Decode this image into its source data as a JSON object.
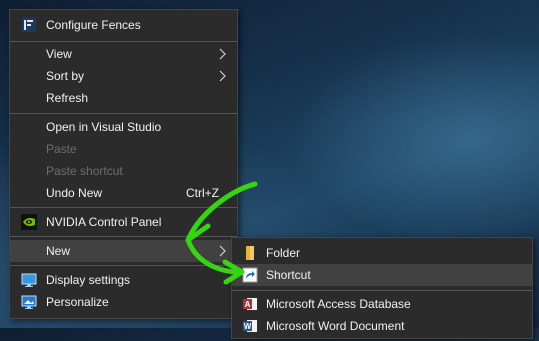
{
  "context_menu": {
    "configure_fences": "Configure Fences",
    "view": "View",
    "sort_by": "Sort by",
    "refresh": "Refresh",
    "open_in_visual_studio": "Open in Visual Studio",
    "paste": "Paste",
    "paste_shortcut": "Paste shortcut",
    "undo_new": "Undo New",
    "undo_new_shortcut": "Ctrl+Z",
    "nvidia_control_panel": "NVIDIA Control Panel",
    "new": "New",
    "display_settings": "Display settings",
    "personalize": "Personalize"
  },
  "new_submenu": {
    "folder": "Folder",
    "shortcut": "Shortcut",
    "access_database": "Microsoft Access Database",
    "word_document": "Microsoft Word Document"
  },
  "colors": {
    "menu_background": "#2b2b2b",
    "hover": "#414141",
    "annotation_arrow": "#35d60f"
  }
}
